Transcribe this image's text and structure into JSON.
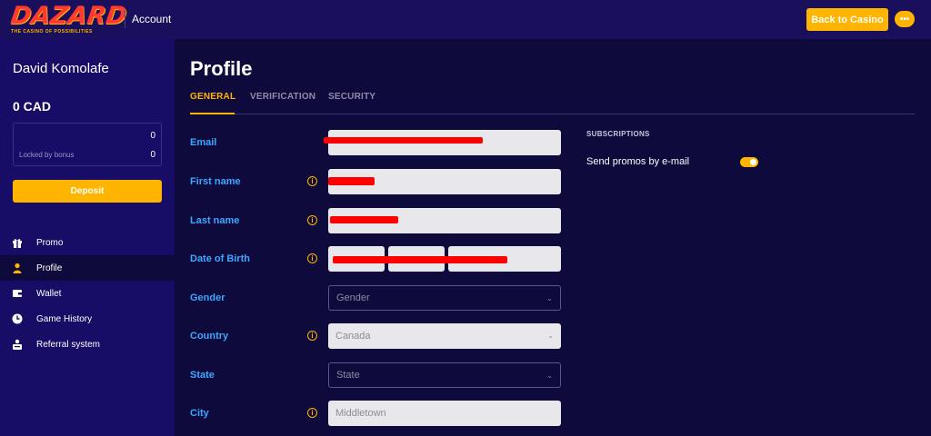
{
  "header": {
    "logo_text": "DAZARD",
    "logo_tagline": "THE CASINO OF POSSIBILITIES",
    "title": "Account",
    "back_label": "Back to Casino",
    "more_label": "•••"
  },
  "sidebar": {
    "user_name": "David Komolafe",
    "balance": "0 CAD",
    "bonus_value": "0",
    "locked_label": "Locked by bonus",
    "locked_value": "0",
    "deposit_label": "Deposit",
    "items": [
      {
        "label": "Promo",
        "icon": "gift-icon"
      },
      {
        "label": "Profile",
        "icon": "user-icon",
        "active": true
      },
      {
        "label": "Wallet",
        "icon": "wallet-icon"
      },
      {
        "label": "Game History",
        "icon": "clock-icon"
      },
      {
        "label": "Referral system",
        "icon": "referral-icon"
      }
    ]
  },
  "main": {
    "title": "Profile",
    "tabs": [
      {
        "label": "GENERAL",
        "active": true
      },
      {
        "label": "VERIFICATION"
      },
      {
        "label": "SECURITY"
      }
    ],
    "fields": {
      "email_label": "Email",
      "first_name_label": "First name",
      "last_name_label": "Last name",
      "dob_label": "Date of Birth",
      "gender_label": "Gender",
      "gender_value": "Gender",
      "country_label": "Country",
      "country_value": "Canada",
      "state_label": "State",
      "state_value": "State",
      "city_label": "City",
      "city_value": "Middletown"
    },
    "subscriptions": {
      "title": "SUBSCRIPTIONS",
      "promo_label": "Send promos by e-mail",
      "promo_enabled": true
    }
  },
  "colors": {
    "accent": "#ffb400",
    "label_blue": "#3da7ff",
    "sidebar_bg": "#180d66",
    "main_bg": "#0f0a3c",
    "redaction": "#ff0000"
  }
}
